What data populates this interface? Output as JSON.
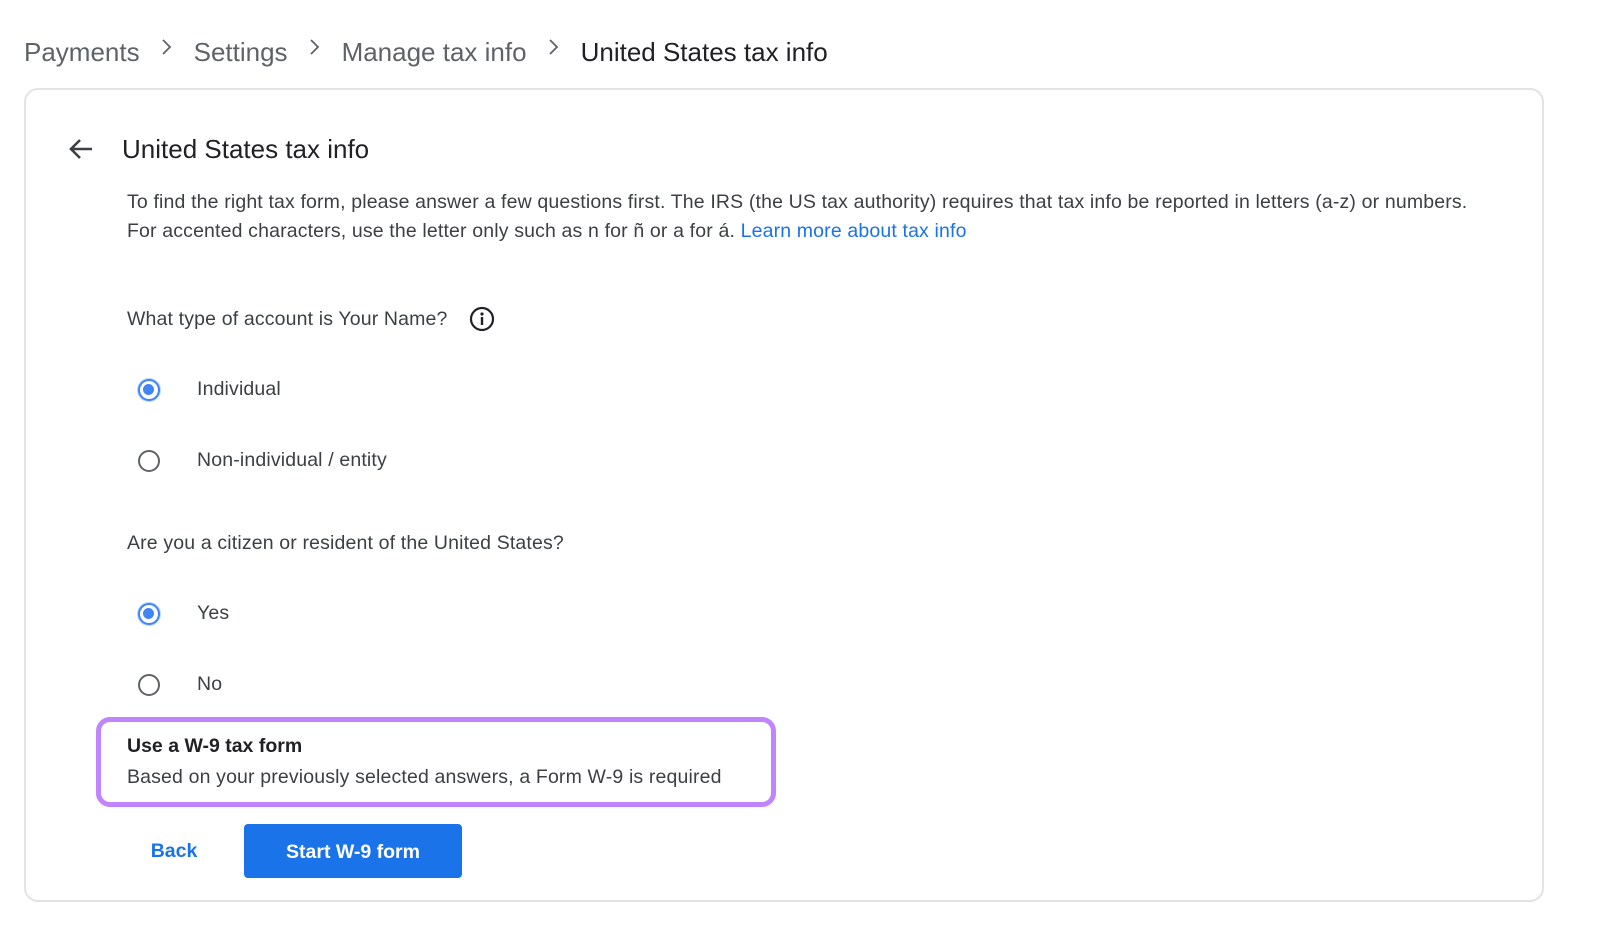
{
  "breadcrumb": [
    {
      "label": "Payments"
    },
    {
      "label": "Settings"
    },
    {
      "label": "Manage tax info"
    },
    {
      "label": "United States tax info"
    }
  ],
  "card": {
    "title": "United States tax info",
    "back_icon": "arrow-back-icon",
    "intro_text": "To find the right tax form, please answer a few questions first. The IRS (the US tax authority) requires that tax info be reported in letters (a-z) or numbers. For accented characters, use the letter only such as n for ñ or a for á. ",
    "intro_link": "Learn more about tax info"
  },
  "questions": [
    {
      "text": "What type of account is Your Name?",
      "info_icon": "info-icon",
      "options": [
        {
          "label": "Individual",
          "checked": true
        },
        {
          "label": "Non-individual / entity",
          "checked": false
        }
      ]
    },
    {
      "text": "Are you a citizen or resident of the United States?",
      "options": [
        {
          "label": "Yes",
          "checked": true
        },
        {
          "label": "No",
          "checked": false
        }
      ]
    }
  ],
  "notice": {
    "title": "Use a W-9 tax form",
    "body": "Based on your previously selected answers, a Form W-9 is required",
    "highlight_color": "#c084fc"
  },
  "actions": {
    "back_label": "Back",
    "primary_label": "Start W-9 form",
    "primary_color": "#1a73e8"
  }
}
